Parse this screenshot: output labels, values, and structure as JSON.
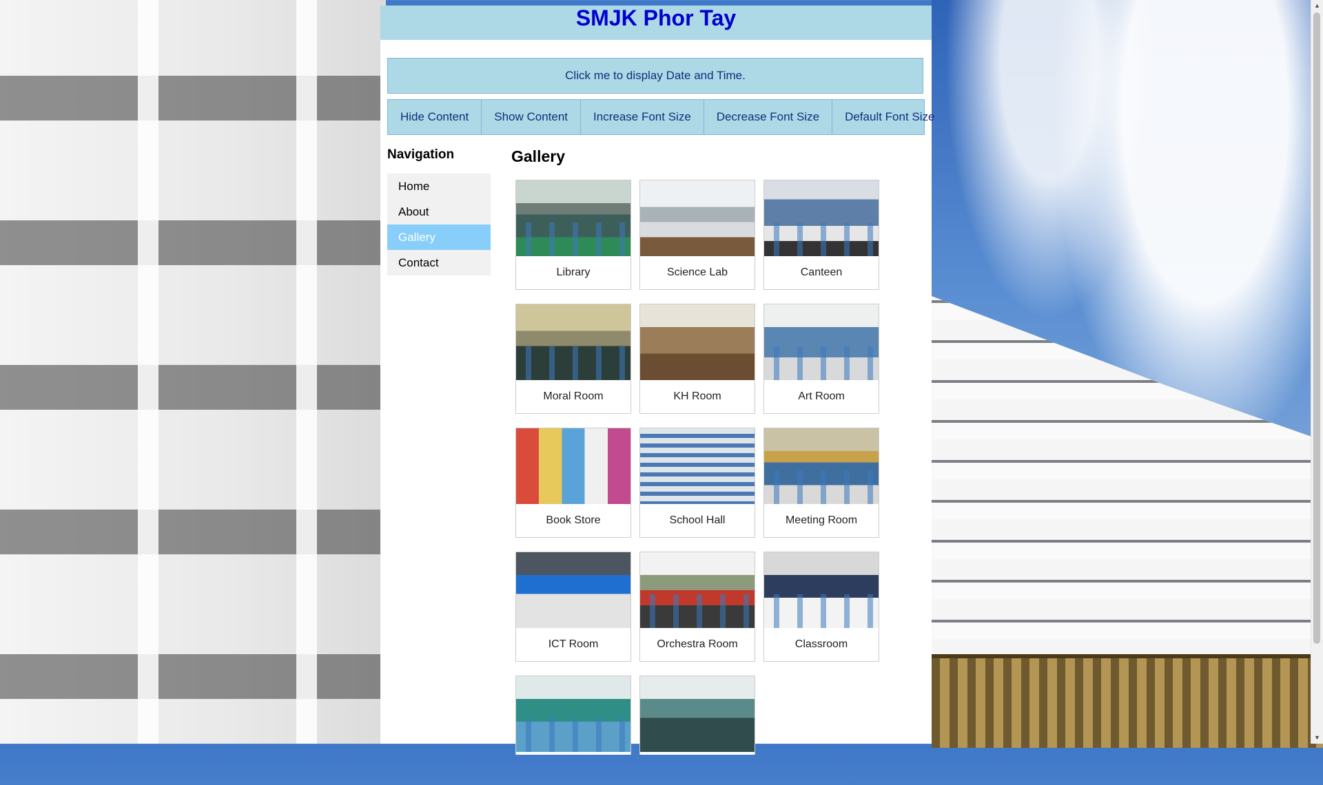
{
  "header": {
    "title": "SMJK Phor Tay"
  },
  "datetime_button": {
    "label": "Click me to display Date and Time."
  },
  "toolbar": {
    "buttons": [
      {
        "label": "Hide Content"
      },
      {
        "label": "Show Content"
      },
      {
        "label": "Increase Font Size"
      },
      {
        "label": "Decrease Font Size"
      },
      {
        "label": "Default Font Size"
      }
    ]
  },
  "navigation": {
    "heading": "Navigation",
    "items": [
      {
        "label": "Home",
        "active": false
      },
      {
        "label": "About",
        "active": false
      },
      {
        "label": "Gallery",
        "active": true
      },
      {
        "label": "Contact",
        "active": false
      }
    ]
  },
  "gallery": {
    "heading": "Gallery",
    "items": [
      {
        "caption": "Library"
      },
      {
        "caption": "Science Lab"
      },
      {
        "caption": "Canteen"
      },
      {
        "caption": "Moral Room"
      },
      {
        "caption": "KH Room"
      },
      {
        "caption": "Art Room"
      },
      {
        "caption": "Book Store"
      },
      {
        "caption": "School Hall"
      },
      {
        "caption": "Meeting Room"
      },
      {
        "caption": "ICT Room"
      },
      {
        "caption": "Orchestra Room"
      },
      {
        "caption": "Classroom"
      },
      {
        "caption": ""
      },
      {
        "caption": ""
      }
    ]
  },
  "colors": {
    "header_bg": "#add8e6",
    "title_color": "#0000cd",
    "nav_active": "#87cefa"
  }
}
